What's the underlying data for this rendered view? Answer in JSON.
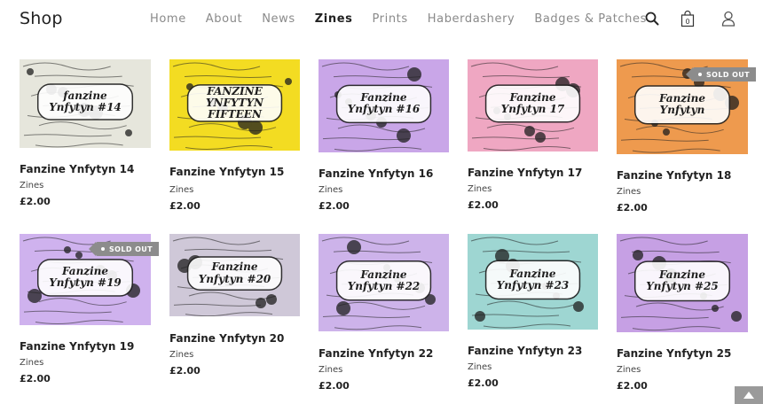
{
  "header": {
    "logo": "Shop",
    "nav": [
      {
        "label": "Home",
        "name": "nav-home",
        "active": false
      },
      {
        "label": "About",
        "name": "nav-about",
        "active": false
      },
      {
        "label": "News",
        "name": "nav-news",
        "active": false
      },
      {
        "label": "Zines",
        "name": "nav-zines",
        "active": true
      },
      {
        "label": "Prints",
        "name": "nav-prints",
        "active": false
      },
      {
        "label": "Haberdashery",
        "name": "nav-haberdashery",
        "active": false
      },
      {
        "label": "Badges & Patches",
        "name": "nav-badges-patches",
        "active": false
      }
    ],
    "cart_count": "0",
    "icons": [
      "search-icon",
      "shopping-bag-icon",
      "user-icon"
    ]
  },
  "colors": {
    "text": "#222222",
    "nav_inactive": "#8a8a8a",
    "sold_out_badge": "#8c8c8c"
  },
  "products": [
    {
      "title": "Fanzine Ynfytyn 14",
      "category": "Zines",
      "price": "£2.00",
      "sold_out": false,
      "cover_color": "#e6e6dc",
      "cover_text": "fanzine Ynfytyn #14"
    },
    {
      "title": "Fanzine Ynfytyn 15",
      "category": "Zines",
      "price": "£2.00",
      "sold_out": false,
      "cover_color": "#f3dc22",
      "cover_text": "FANZINE YNFYTYN FIFTEEN"
    },
    {
      "title": "Fanzine Ynfytyn 16",
      "category": "Zines",
      "price": "£2.00",
      "sold_out": false,
      "cover_color": "#c9a6e8",
      "cover_text": "Fanzine Ynfytyn #16"
    },
    {
      "title": "Fanzine Ynfytyn 17",
      "category": "Zines",
      "price": "£2.00",
      "sold_out": false,
      "cover_color": "#efa7c2",
      "cover_text": "Fanzine Ynfytyn 17"
    },
    {
      "title": "Fanzine Ynfytyn 18",
      "category": "Zines",
      "price": "£2.00",
      "sold_out": true,
      "sold_out_label": "SOLD OUT",
      "cover_color": "#ee9a4e",
      "cover_text": "Fanzine Ynfytyn"
    },
    {
      "title": "Fanzine Ynfytyn 19",
      "category": "Zines",
      "price": "£2.00",
      "sold_out": true,
      "sold_out_label": "SOLD OUT",
      "cover_color": "#cfb2ee",
      "cover_text": "Fanzine Ynfytyn #19"
    },
    {
      "title": "Fanzine Ynfytyn 20",
      "category": "Zines",
      "price": "£2.00",
      "sold_out": false,
      "cover_color": "#cfc8d8",
      "cover_text": "Fanzine Ynfytyn #20"
    },
    {
      "title": "Fanzine Ynfytyn 22",
      "category": "Zines",
      "price": "£2.00",
      "sold_out": false,
      "cover_color": "#cdb3ea",
      "cover_text": "Fanzine Ynfytyn #22"
    },
    {
      "title": "Fanzine Ynfytyn 23",
      "category": "Zines",
      "price": "£2.00",
      "sold_out": false,
      "cover_color": "#9ed6d2",
      "cover_text": "Fanzine Ynfytyn #23"
    },
    {
      "title": "Fanzine Ynfytyn 25",
      "category": "Zines",
      "price": "£2.00",
      "sold_out": false,
      "cover_color": "#c6a0e4",
      "cover_text": "Fanzine Ynfytyn #25"
    }
  ]
}
